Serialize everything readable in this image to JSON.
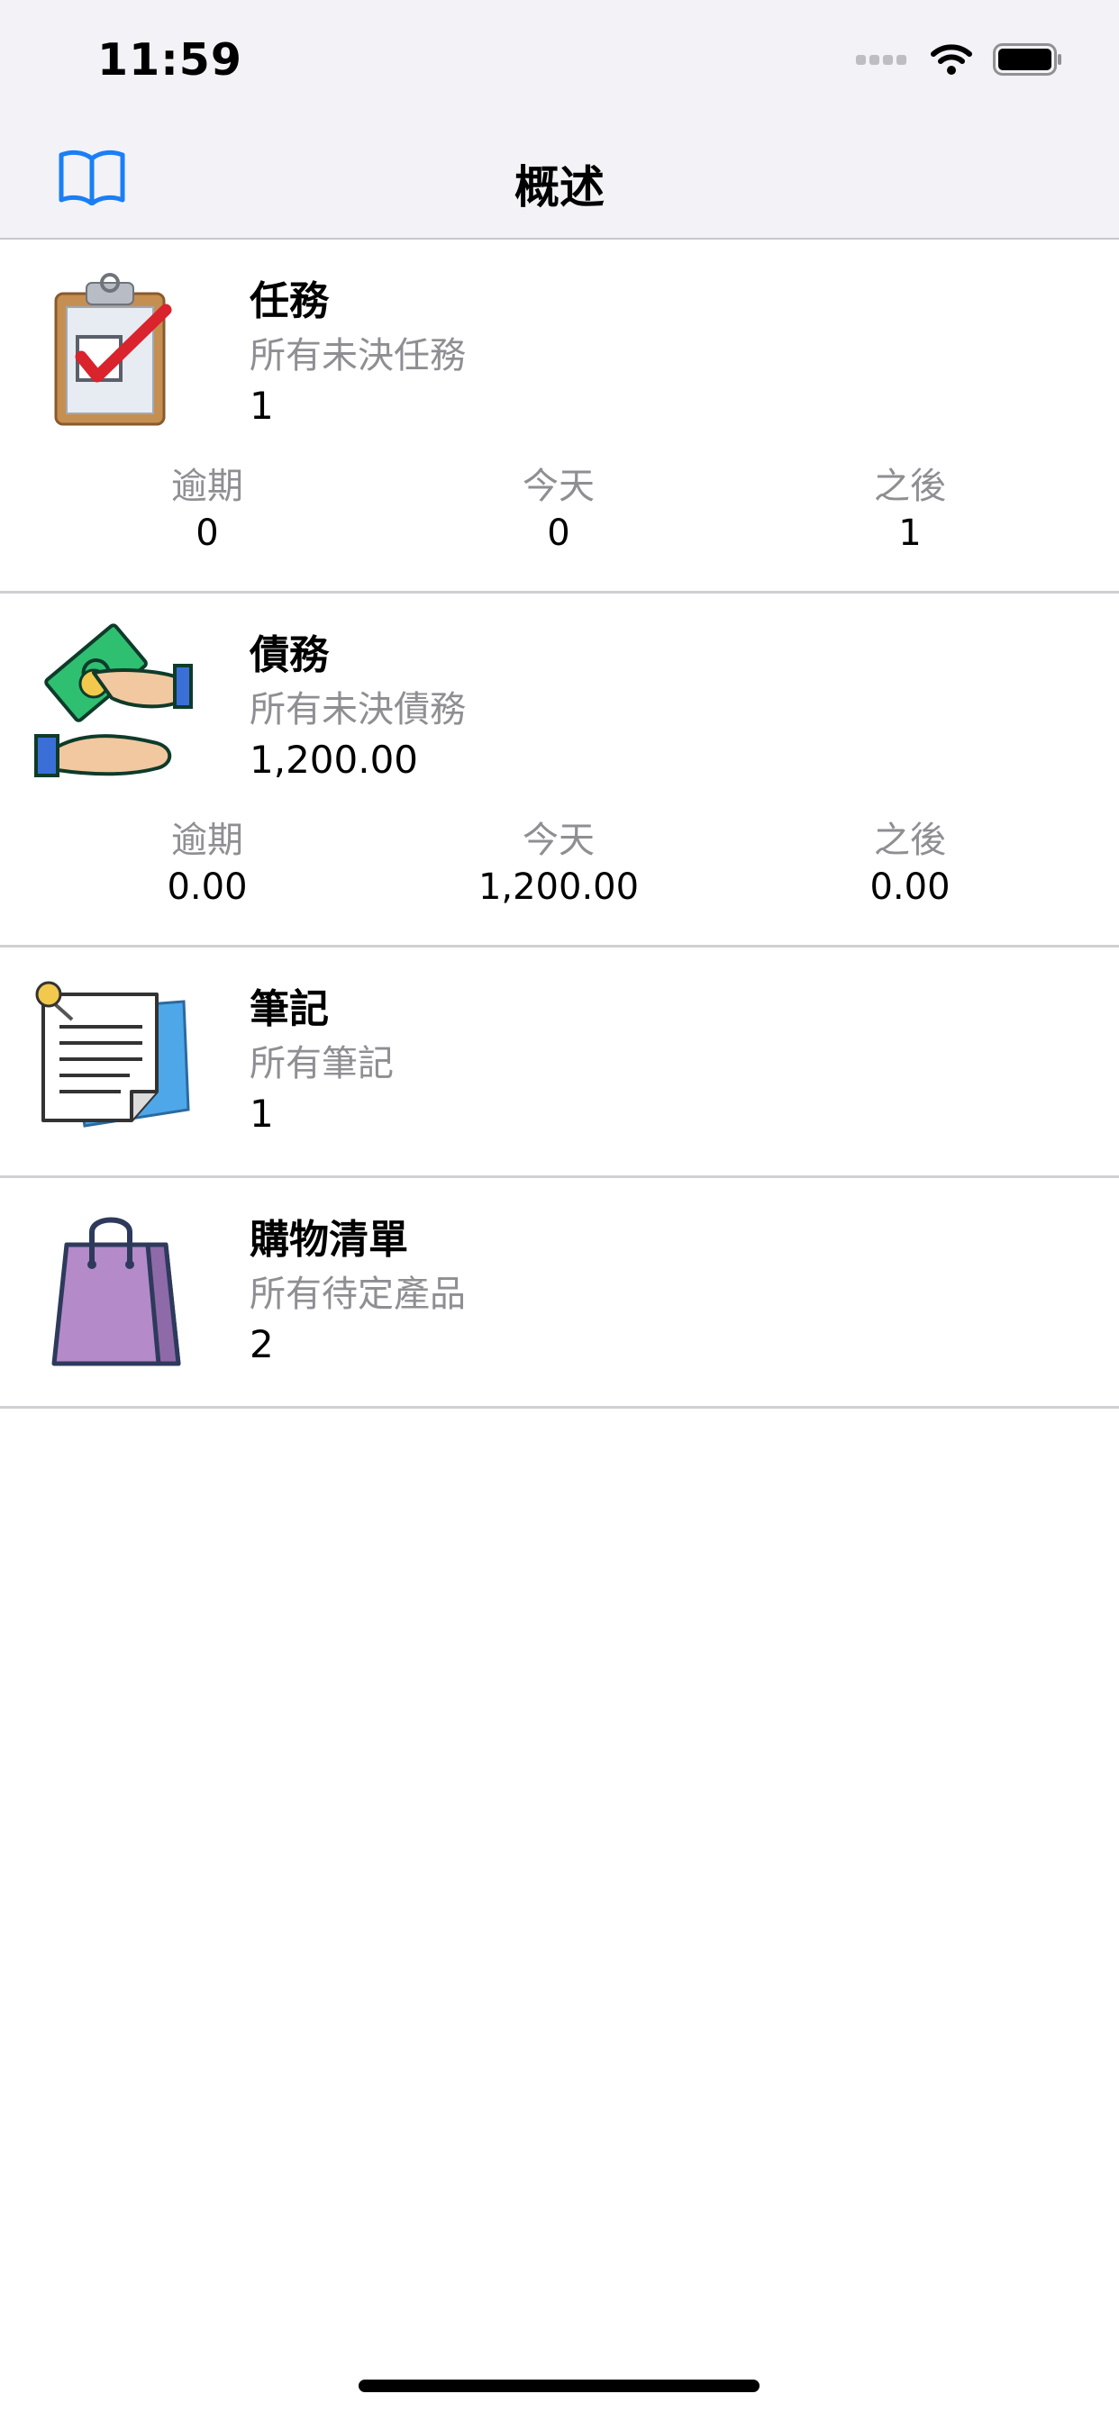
{
  "status_bar": {
    "time": "11:59"
  },
  "nav": {
    "title": "概述",
    "left_icon": "book-icon"
  },
  "sections": [
    {
      "id": "tasks",
      "icon": "clipboard-check-icon",
      "title": "任務",
      "subtitle": "所有未決任務",
      "count": "1",
      "stats": [
        {
          "label": "逾期",
          "value": "0"
        },
        {
          "label": "今天",
          "value": "0"
        },
        {
          "label": "之後",
          "value": "1"
        }
      ]
    },
    {
      "id": "debts",
      "icon": "money-hands-icon",
      "title": "債務",
      "subtitle": "所有未決債務",
      "count": "1,200.00",
      "stats": [
        {
          "label": "逾期",
          "value": "0.00"
        },
        {
          "label": "今天",
          "value": "1,200.00"
        },
        {
          "label": "之後",
          "value": "0.00"
        }
      ]
    },
    {
      "id": "notes",
      "icon": "note-pin-icon",
      "title": "筆記",
      "subtitle": "所有筆記",
      "count": "1"
    },
    {
      "id": "shopping",
      "icon": "shopping-bag-icon",
      "title": "購物清單",
      "subtitle": "所有待定產品",
      "count": "2"
    }
  ],
  "colors": {
    "accent": "#1a7ff5",
    "secondary_text": "#8e8e93",
    "nav_background": "#f2f2f7",
    "bag_purple": "#b48ac8"
  }
}
